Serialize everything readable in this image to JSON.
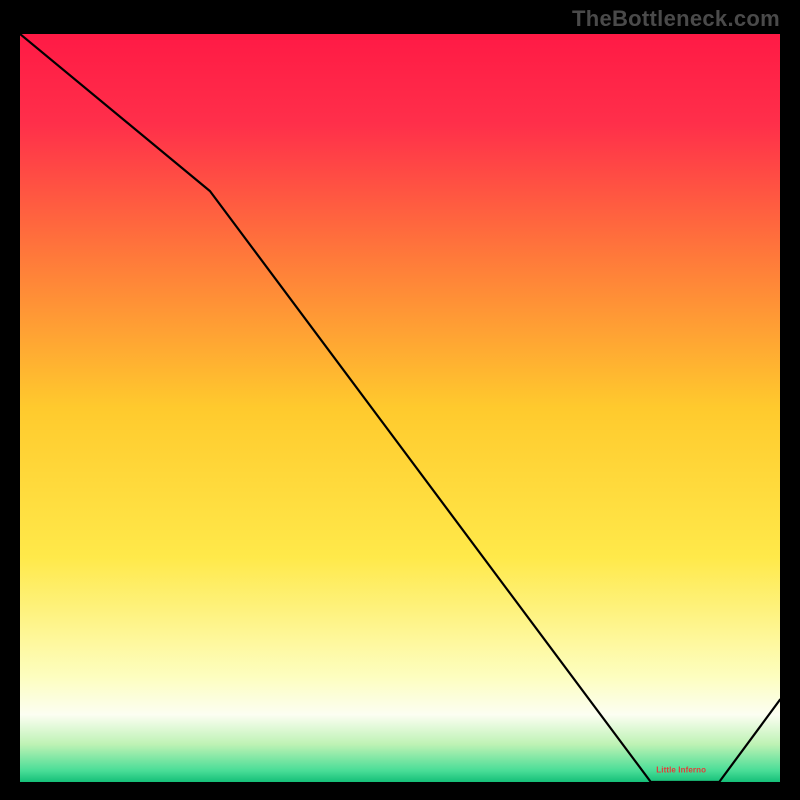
{
  "watermark": "TheBottleneck.com",
  "chart_data": {
    "type": "line",
    "title": "",
    "xlabel": "",
    "ylabel": "",
    "x": [
      0.0,
      0.25,
      0.83,
      0.92,
      1.0
    ],
    "values": [
      1.0,
      0.79,
      0.0,
      0.0,
      0.11
    ],
    "xlim": [
      0,
      1
    ],
    "ylim": [
      0,
      1
    ],
    "annotations": [
      {
        "text": "Little Inferno",
        "x": 0.87,
        "y": 0.013
      }
    ],
    "gradient_stops": [
      {
        "offset": 0.0,
        "color": "#ff1a45"
      },
      {
        "offset": 0.12,
        "color": "#ff2f4a"
      },
      {
        "offset": 0.3,
        "color": "#ff7a3a"
      },
      {
        "offset": 0.5,
        "color": "#ffca2d"
      },
      {
        "offset": 0.7,
        "color": "#ffe94a"
      },
      {
        "offset": 0.86,
        "color": "#fdfec0"
      },
      {
        "offset": 0.91,
        "color": "#fcfef2"
      },
      {
        "offset": 0.95,
        "color": "#bdf2b4"
      },
      {
        "offset": 0.985,
        "color": "#49dd97"
      },
      {
        "offset": 1.0,
        "color": "#15bf78"
      }
    ]
  }
}
